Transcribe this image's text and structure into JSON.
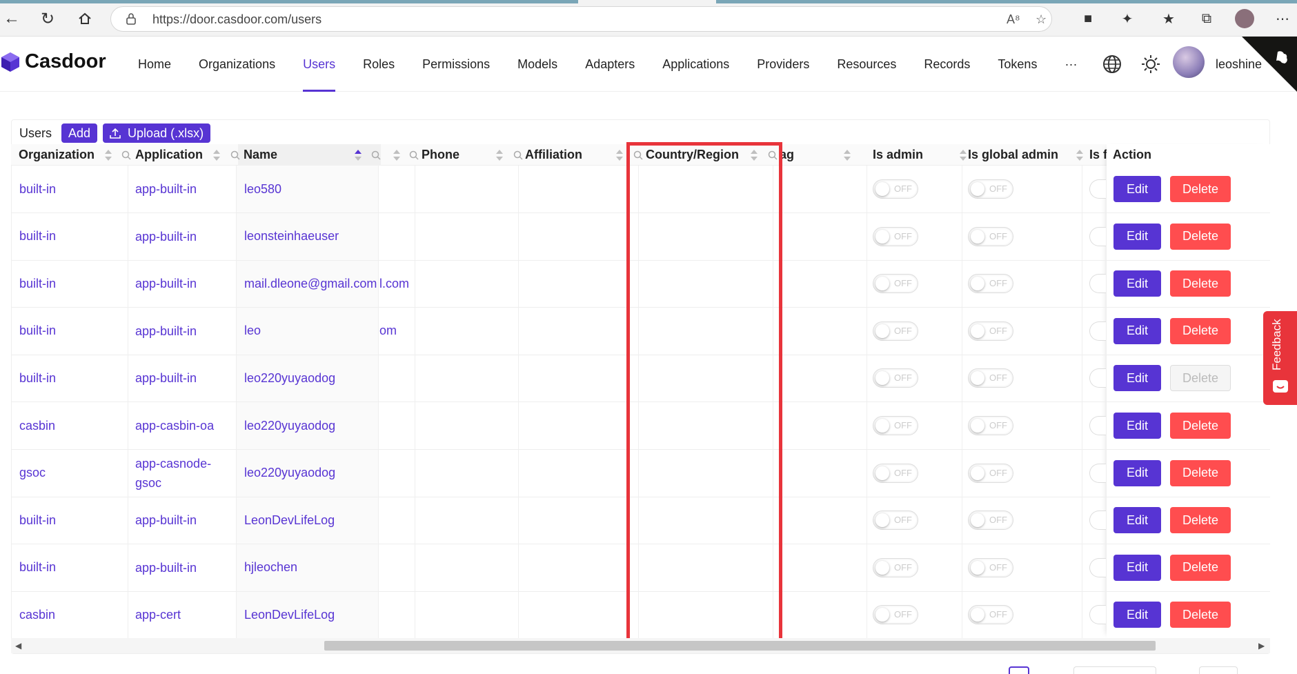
{
  "browser": {
    "url": "https://door.casdoor.com/users"
  },
  "header": {
    "logo_text": "Casdoor",
    "menu": [
      {
        "label": "Home"
      },
      {
        "label": "Organizations"
      },
      {
        "label": "Users",
        "active": true
      },
      {
        "label": "Roles"
      },
      {
        "label": "Permissions"
      },
      {
        "label": "Models"
      },
      {
        "label": "Adapters"
      },
      {
        "label": "Applications"
      },
      {
        "label": "Providers"
      },
      {
        "label": "Resources"
      },
      {
        "label": "Records"
      },
      {
        "label": "Tokens"
      },
      {
        "label": "···"
      }
    ],
    "username": "leoshine"
  },
  "toolbar": {
    "title": "Users",
    "add_label": "Add",
    "upload_label": "Upload (.xlsx)"
  },
  "columns": {
    "organization": "Organization",
    "application": "Application",
    "name": "Name",
    "phone": "Phone",
    "affiliation": "Affiliation",
    "country": "Country/Region",
    "tag": "Tag",
    "is_admin": "Is admin",
    "is_global_admin": "Is global admin",
    "is_forbidden": "Is f",
    "action": "Action"
  },
  "rows": [
    {
      "organization": "built-in",
      "application": "app-built-in",
      "name": "leo580",
      "email_fragment": "",
      "delete_enabled": true
    },
    {
      "organization": "built-in",
      "application": "app-built-in",
      "name": "leonsteinhaeuser",
      "email_fragment": "",
      "delete_enabled": true
    },
    {
      "organization": "built-in",
      "application": "app-built-in",
      "name": "mail.dleone@gmail.com",
      "email_fragment": "l.com",
      "delete_enabled": true
    },
    {
      "organization": "built-in",
      "application": "app-built-in",
      "name": "leo",
      "email_fragment": "om",
      "delete_enabled": true
    },
    {
      "organization": "built-in",
      "application": "app-built-in",
      "name": "leo220yuyaodog",
      "email_fragment": "",
      "delete_enabled": false
    },
    {
      "organization": "casbin",
      "application": "app-casbin-oa",
      "name": "leo220yuyaodog",
      "email_fragment": "",
      "delete_enabled": true
    },
    {
      "organization": "gsoc",
      "application": "app-casnode-gsoc",
      "name": "leo220yuyaodog",
      "email_fragment": "",
      "delete_enabled": true
    },
    {
      "organization": "built-in",
      "application": "app-built-in",
      "name": "LeonDevLifeLog",
      "email_fragment": "",
      "delete_enabled": true
    },
    {
      "organization": "built-in",
      "application": "app-built-in",
      "name": "hjleochen",
      "email_fragment": "",
      "delete_enabled": true
    },
    {
      "organization": "casbin",
      "application": "app-cert",
      "name": "LeonDevLifeLog",
      "email_fragment": "",
      "delete_enabled": true
    }
  ],
  "toggle_label": "OFF",
  "edit_label": "Edit",
  "delete_label": "Delete",
  "feedback_label": "Feedback",
  "colors": {
    "accent": "#5734d3",
    "danger": "#ff4d4f",
    "highlight": "#e8343b"
  }
}
